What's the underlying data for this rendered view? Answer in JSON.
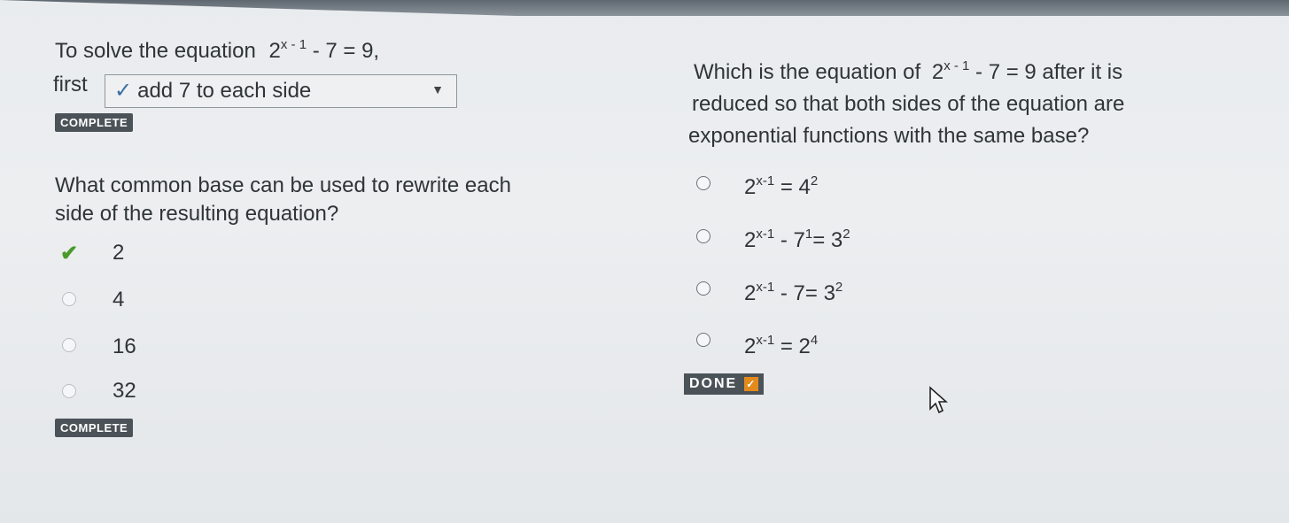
{
  "left": {
    "q1": {
      "prefix": "To solve the equation",
      "eq_base": "2",
      "eq_exp": "x - 1",
      "eq_rest": " - 7 = 9,",
      "first_label": "first",
      "dropdown_value": "add 7 to each side",
      "status": "COMPLETE"
    },
    "q2": {
      "line1": "What common base can be used to rewrite each",
      "line2": "side of the resulting equation?",
      "options": [
        "2",
        "4",
        "16",
        "32"
      ],
      "selected_index": 0,
      "status": "COMPLETE"
    }
  },
  "right": {
    "q3": {
      "line1_pre": "Which is the equation of",
      "eq_base": "2",
      "eq_exp": "x - 1",
      "eq_rest": " - 7 = 9",
      "line1_post": " after it is",
      "line2": "reduced so that both sides of the equation are",
      "line3": "exponential functions with the same base?",
      "options": [
        {
          "base": "2",
          "exp": "x-1",
          "mid": " = 4",
          "exp2": "2",
          "tail": ""
        },
        {
          "base": "2",
          "exp": "x-1",
          "mid": " - 7",
          "exp2": "1",
          "tail": "= 3",
          "exp3": "2"
        },
        {
          "base": "2",
          "exp": "x-1",
          "mid": " - 7= 3",
          "exp2": "2",
          "tail": ""
        },
        {
          "base": "2",
          "exp": "x-1",
          "mid": " = 2",
          "exp2": "4",
          "tail": ""
        }
      ],
      "done_label": "DONE"
    }
  },
  "icons": {
    "check": "check-icon",
    "chevron": "chevron-down-icon",
    "cursor": "mouse-pointer-icon"
  },
  "colors": {
    "badge": "#4b5258",
    "check_green": "#4a9a2a",
    "done_accent": "#e38a1c"
  }
}
